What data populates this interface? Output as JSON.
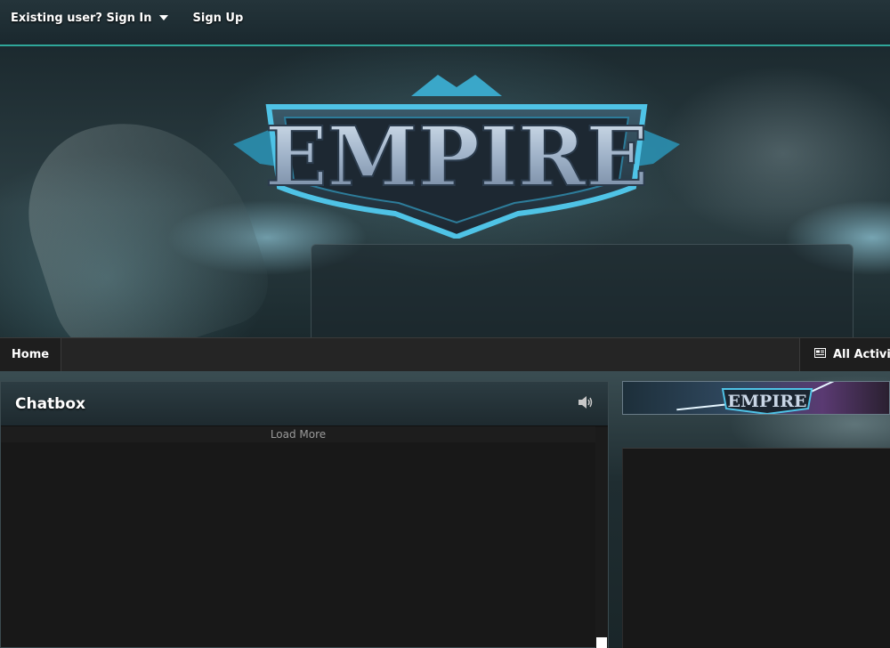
{
  "userbar": {
    "sign_in_label": "Existing user? Sign In",
    "sign_up_label": "Sign Up"
  },
  "header": {
    "logo_text": "EMPIRE"
  },
  "nav": {
    "home_label": "Home",
    "activity_label": "All Activity",
    "activity_icon": "newspaper-icon"
  },
  "chatbox": {
    "title": "Chatbox",
    "load_more_label": "Load More",
    "sound_icon": "speaker-icon"
  },
  "sidebar": {
    "banner_text": "EMPIRE"
  },
  "colors": {
    "accent": "#2fa79a",
    "nav_bg": "#252525",
    "panel_bg": "#181818"
  }
}
